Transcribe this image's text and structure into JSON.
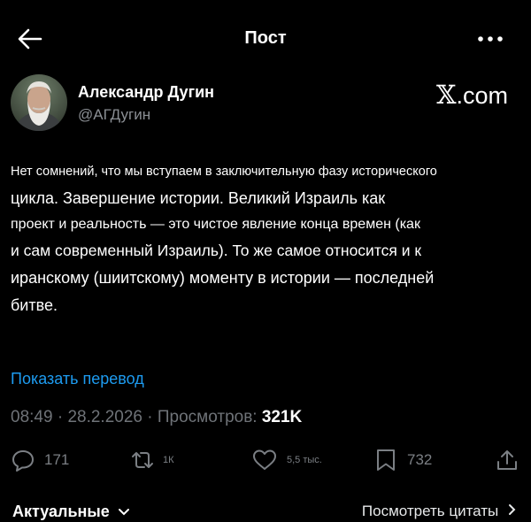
{
  "header": {
    "title": "Пост"
  },
  "author": {
    "name": "Александр Дугин",
    "handle": "@АГДугин"
  },
  "watermark": {
    "brand": "𝕏",
    "suffix": ".com"
  },
  "post": {
    "lines": [
      "Нет сомнений, что мы вступаем в заключительную фазу исторического",
      "цикла. Завершение истории. Великий Израиль как",
      "проект и реальность — это чистое явление конца времен (как",
      "и сам современный Израиль). То же самое относится и к",
      "иранскому (шиитскому) моменту в истории — последней",
      "битве."
    ]
  },
  "translate_label": "Показать перевод",
  "meta": {
    "time": "08:49",
    "date": "28.2.2026",
    "views_label": "Просмотров:",
    "views_count": "321K",
    "separator": "·"
  },
  "actions": {
    "replies": "171",
    "reposts": "1К",
    "likes": "5,5 тыс.",
    "bookmarks": "732"
  },
  "bottom": {
    "latest_label": "Актуальные",
    "view_quotes_label": "Посмотреть цитаты"
  },
  "icons": {
    "back": "arrow-left-icon",
    "more": "more-horizontal-icon",
    "reply": "reply-icon",
    "repost": "repost-icon",
    "like": "heart-icon",
    "bookmark": "bookmark-icon",
    "share": "share-icon"
  },
  "colors": {
    "background": "#000000",
    "text": "#ffffff",
    "muted": "#71767b",
    "link": "#1d9bf0"
  }
}
